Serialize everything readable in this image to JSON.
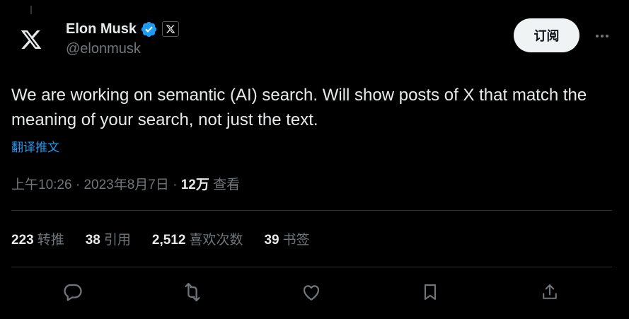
{
  "author": {
    "name": "Elon Musk",
    "handle": "@elonmusk",
    "verified": true
  },
  "header": {
    "subscribe_label": "订阅"
  },
  "tweet": {
    "text": "We are working on semantic (AI) search. Will show posts of X that match the meaning of your search, not just the text.",
    "translate_label": "翻译推文",
    "time": "上午10:26",
    "sep1": " · ",
    "date": "2023年8月7日",
    "sep2": " · ",
    "views_count": "12万",
    "views_label": " 查看"
  },
  "stats": [
    {
      "count": "223",
      "label": "转推"
    },
    {
      "count": "38",
      "label": "引用"
    },
    {
      "count": "2,512",
      "label": "喜欢次数"
    },
    {
      "count": "39",
      "label": "书签"
    }
  ],
  "icons": {
    "avatar": "x-logo-icon",
    "verified": "verified-badge-icon",
    "affiliation": "x-affiliation-icon",
    "more": "more-options-icon",
    "reply": "reply-icon",
    "retweet": "retweet-icon",
    "like": "like-icon",
    "bookmark": "bookmark-icon",
    "share": "share-icon"
  },
  "colors": {
    "background": "#000000",
    "text": "#e7e9ea",
    "muted": "#71767b",
    "accent": "#1d9bf0",
    "divider": "#2f3336",
    "button_bg": "#eff3f4"
  }
}
